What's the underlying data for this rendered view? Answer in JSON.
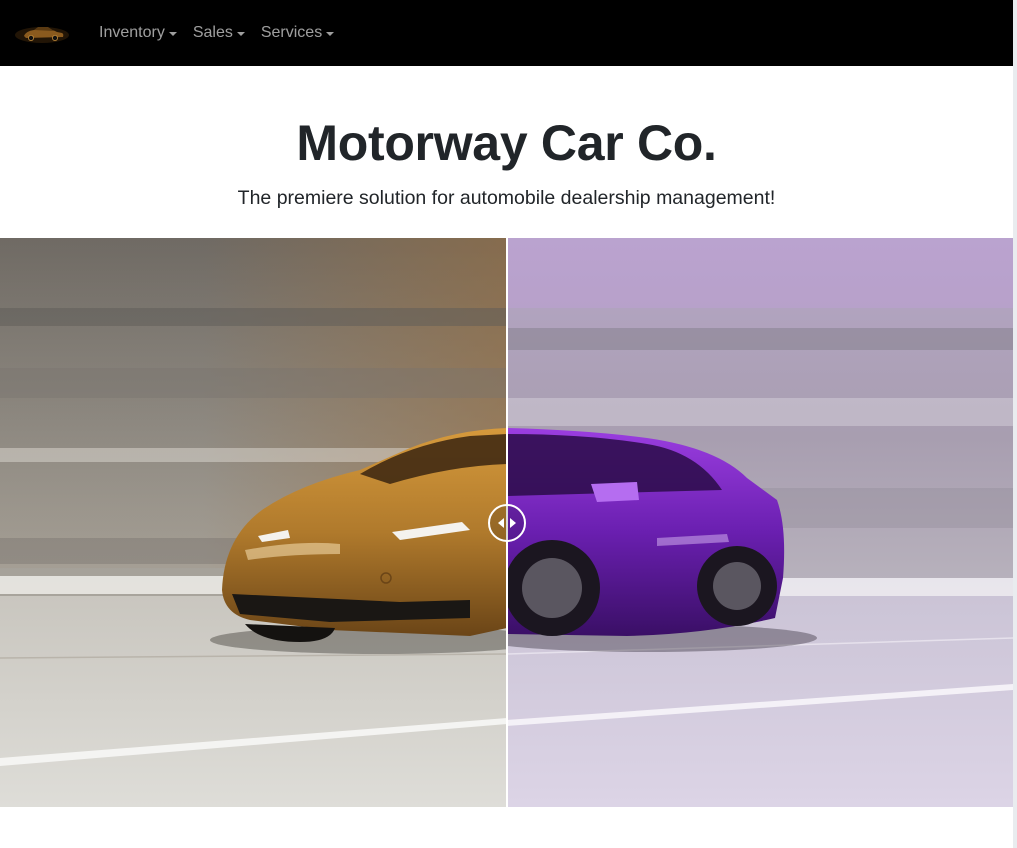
{
  "navbar": {
    "brand_icon": "car-logo-icon",
    "items": [
      {
        "label": "Inventory"
      },
      {
        "label": "Sales"
      },
      {
        "label": "Services"
      }
    ]
  },
  "hero": {
    "title": "Motorway Car Co.",
    "subtitle": "The premiere solution for automobile dealership management!"
  },
  "comparison": {
    "before_color": "#b07a2c",
    "after_color": "#6a1fb0",
    "slider_position": 0.5
  },
  "colors": {
    "navbar_bg": "#000000",
    "text": "#212529"
  }
}
